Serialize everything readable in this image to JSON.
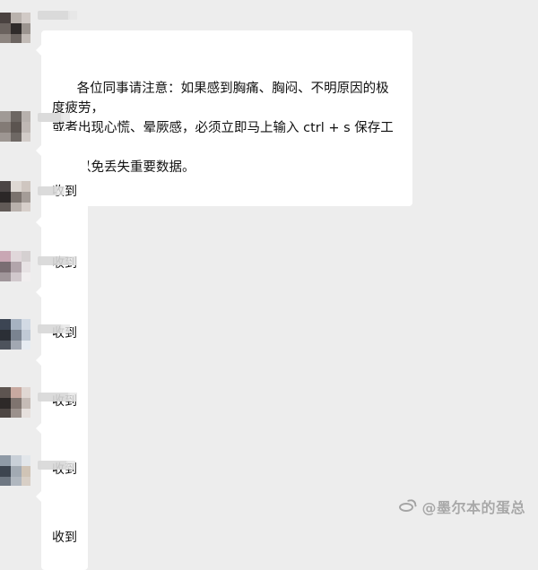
{
  "conversation": {
    "messages": [
      {
        "avatar_icon": "blurred-avatar-icon",
        "text": "各位同事请注意：如果感到胸痛、胸闷、不明原因的极度疲劳，\n或者出现心慌、晕厥感，必须立即马上输入 ctrl + s 保存工作内\n容，以免丢失重要数据。"
      },
      {
        "avatar_icon": "blurred-avatar-icon",
        "text": "收到"
      },
      {
        "avatar_icon": "blurred-avatar-icon",
        "text": "收到"
      },
      {
        "avatar_icon": "blurred-avatar-icon",
        "text": "收到"
      },
      {
        "avatar_icon": "blurred-avatar-icon",
        "text": "收到"
      },
      {
        "avatar_icon": "blurred-avatar-icon",
        "text": "收到"
      },
      {
        "avatar_icon": "blurred-avatar-icon",
        "text": "收到"
      }
    ]
  },
  "watermark": {
    "logo_icon": "weibo-logo-icon",
    "text": "@墨尔本的蛋总"
  },
  "colors": {
    "background": "#ededed",
    "bubble": "#ffffff",
    "text": "#111111"
  }
}
